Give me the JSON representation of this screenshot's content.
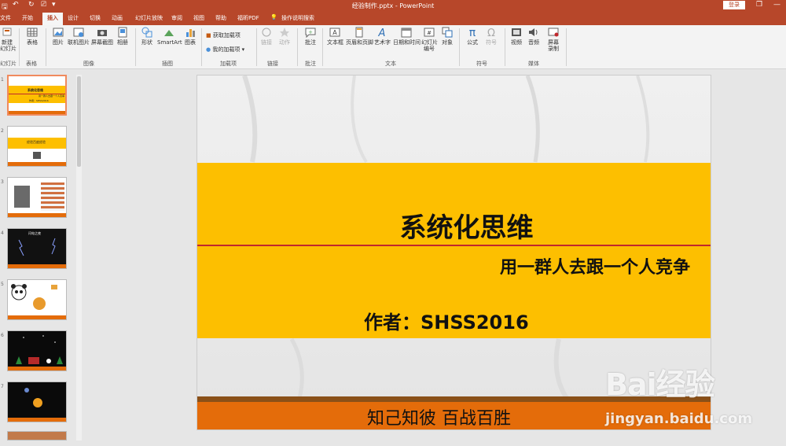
{
  "window": {
    "doc_title": "经验制作.pptx - PowerPoint",
    "login": "登录",
    "min_glyph": "—",
    "restore_glyph": "❐"
  },
  "tabs": [
    {
      "label": "文件"
    },
    {
      "label": "开始"
    },
    {
      "label": "插入",
      "active": true
    },
    {
      "label": "设计"
    },
    {
      "label": "切换"
    },
    {
      "label": "动画"
    },
    {
      "label": "幻灯片放映"
    },
    {
      "label": "审阅"
    },
    {
      "label": "视图"
    },
    {
      "label": "帮助"
    },
    {
      "label": "福昕PDF"
    },
    {
      "label": "操作说明搜索"
    }
  ],
  "ribbon": {
    "new_slide": "新建\n幻灯片",
    "table": "表格",
    "picture": "图片",
    "online_picture": "联机图片",
    "screenshot": "屏幕截图",
    "album": "相册",
    "shapes": "形状",
    "smartart": "SmartArt",
    "chart": "图表",
    "get_addins": "获取加载项",
    "my_addins": "我的加载项",
    "link": "链接",
    "action": "动作",
    "comment": "批注",
    "textbox": "文本框",
    "header_footer": "页眉和页脚",
    "wordart": "艺术字",
    "datetime": "日期和时间",
    "slide_number": "幻灯片\n编号",
    "object": "对象",
    "equation": "公式",
    "symbol": "符号",
    "video": "视频",
    "audio": "音频",
    "screen_record": "屏幕\n录制",
    "groups": {
      "slides": "幻灯片",
      "tables": "表格",
      "images": "图像",
      "illustrations": "插图",
      "addins": "加载项",
      "links": "链接",
      "comments": "批注",
      "text": "文本",
      "symbols": "符号",
      "media": "媒体"
    }
  },
  "thumbnails": [
    {
      "num": "1",
      "title": "系统化思维",
      "sub": "用一群人去跟一个人竞争",
      "author": "作者：SHSS2016"
    },
    {
      "num": "2",
      "title": "经验百度经验"
    },
    {
      "num": "3",
      "title": ""
    },
    {
      "num": "4",
      "title": "闪电之夜"
    },
    {
      "num": "5",
      "title": ""
    },
    {
      "num": "6",
      "title": ""
    },
    {
      "num": "7",
      "title": ""
    }
  ],
  "slide": {
    "title": "系统化思维",
    "subtitle": "用一群人去跟一个人竞争",
    "author": "作者：SHSS2016",
    "footer": "知己知彼 百战百胜"
  },
  "colors": {
    "brand": "#b7472a",
    "yellow_band": "#fdbf00",
    "orange_footer": "#e46c0a",
    "red_line": "#c0282d"
  },
  "watermark": {
    "text": "Bai经验",
    "url": "jingyan.baidu.com"
  }
}
